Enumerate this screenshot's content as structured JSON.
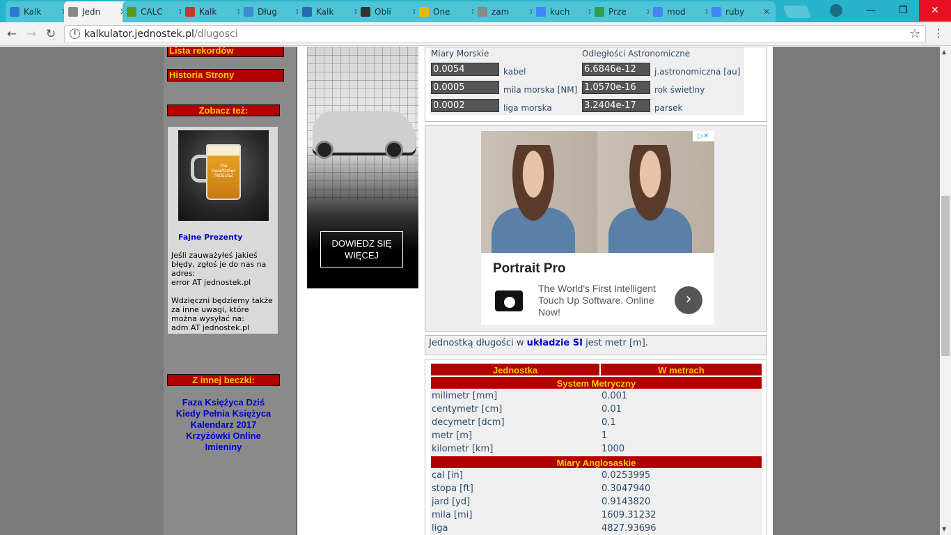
{
  "tabs": [
    {
      "label": "Kalk",
      "favicon": "wolfram-icon",
      "color": "#2a7bd0"
    },
    {
      "label": "Jedn",
      "favicon": "page-icon",
      "color": "#888888",
      "active": true
    },
    {
      "label": "CALC",
      "favicon": "calc-icon",
      "color": "#5a9a1a"
    },
    {
      "label": "Kalk",
      "favicon": "percent-icon",
      "color": "#c0392b"
    },
    {
      "label": "Dług",
      "favicon": "c-icon",
      "color": "#3b8bd0"
    },
    {
      "label": "Kalk",
      "favicon": "calculator-icon",
      "color": "#2a6ab0"
    },
    {
      "label": "Obli",
      "favicon": "cap-icon",
      "color": "#333333"
    },
    {
      "label": "One",
      "favicon": "coin-icon",
      "color": "#e6b800"
    },
    {
      "label": "zam",
      "favicon": "page-icon",
      "color": "#888888"
    },
    {
      "label": "kuch",
      "favicon": "google-icon",
      "color": "#4285f4"
    },
    {
      "label": "Prze",
      "favicon": "sheet-icon",
      "color": "#2e9e4a"
    },
    {
      "label": "mod",
      "favicon": "google-icon",
      "color": "#4285f4"
    },
    {
      "label": "ruby",
      "favicon": "google-icon",
      "color": "#4285f4"
    }
  ],
  "address": {
    "host": "kalkulator.jednostek.pl",
    "path": "/dlugosci"
  },
  "sidebar": {
    "records": "Lista rekordów",
    "history": "Historia Strony",
    "see_also": "Zobacz też:",
    "promo_link": "Fajne Prezenty",
    "beer_text": "The Goodfather TADEUSZ",
    "promo_text_1": "Jeśli zauważyłeś jakieś błędy, zgłoś je do nas na adres:",
    "promo_text_2": "error AT jednostek.pl",
    "promo_text_3": "Wdzięczni będziemy także za inne uwagi, które można wysyłać na:",
    "promo_text_4": "adm AT jednostek.pl",
    "other_head": "Z innej beczki:",
    "other_links": [
      "Faza Księżyca Dziś",
      "Kiedy Pełnia Księżyca",
      "Kalendarz 2017",
      "Krzyżówki Online",
      "Imieniny"
    ]
  },
  "volvo_ad": {
    "button": "DOWIEDZ SIĘ WIĘCEJ"
  },
  "converter": {
    "marine_title": "Miary Morskie",
    "astro_title": "Odległości Astronomiczne",
    "marine": [
      {
        "value": "0.0054",
        "unit": "kabel"
      },
      {
        "value": "0.0005",
        "unit": "mila morska [NM]"
      },
      {
        "value": "0.0002",
        "unit": "liga morska"
      }
    ],
    "astro": [
      {
        "value": "6.6846e-12",
        "unit": "j.astronomiczna [au]"
      },
      {
        "value": "1.0570e-16",
        "unit": "rok świetlny"
      },
      {
        "value": "3.2404e-17",
        "unit": "parsek"
      }
    ]
  },
  "portrait_ad": {
    "title": "Portrait Pro",
    "desc": "The World's First Intelligent Touch Up Software. Online Now!",
    "adchoices": "▷✕"
  },
  "si_note": {
    "pre": "Jednostką długości w ",
    "link": "układzie SI",
    "post": " jest metr [m]."
  },
  "table": {
    "col1": "Jednostka",
    "col2": "W metrach",
    "sections": [
      {
        "title": "System Metryczny",
        "rows": [
          [
            "milimetr [mm]",
            "0.001"
          ],
          [
            "centymetr [cm]",
            "0.01"
          ],
          [
            "decymetr [dcm]",
            "0.1"
          ],
          [
            "metr [m]",
            "1"
          ],
          [
            "kilometr [km]",
            "1000"
          ]
        ]
      },
      {
        "title": "Miary Anglosaskie",
        "rows": [
          [
            "cal [in]",
            "0.0253995"
          ],
          [
            "stopa [ft]",
            "0.3047940"
          ],
          [
            "jard [yd]",
            "0.9143820"
          ],
          [
            "mila [mi]",
            "1609.31232"
          ],
          [
            "liga",
            "4827.93696"
          ]
        ]
      }
    ]
  }
}
